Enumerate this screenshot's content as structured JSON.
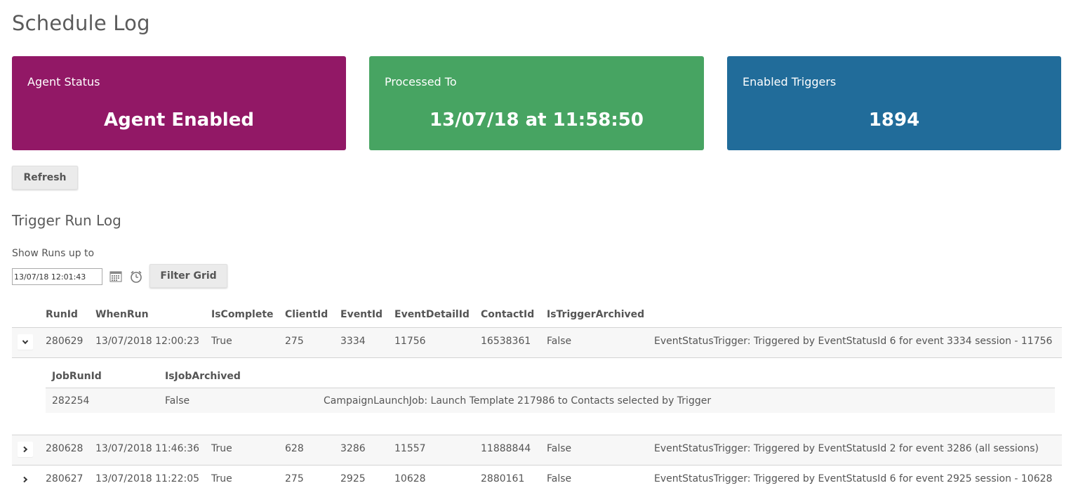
{
  "page": {
    "title": "Schedule Log"
  },
  "cards": {
    "agent_status": {
      "label": "Agent Status",
      "value": "Agent Enabled",
      "color": "#921866"
    },
    "processed_to": {
      "label": "Processed To",
      "value": "13/07/18 at 11:58:50",
      "color": "#47a462"
    },
    "enabled_triggers": {
      "label": "Enabled Triggers",
      "value": "1894",
      "color": "#216c9a"
    }
  },
  "toolbar": {
    "refresh_label": "Refresh"
  },
  "trigger_log": {
    "title": "Trigger Run Log",
    "filter_label": "Show Runs up to",
    "date_value": "13/07/18 12:01:43",
    "filter_button": "Filter Grid",
    "icons": [
      "calendar-icon",
      "clock-icon"
    ]
  },
  "grid": {
    "columns": [
      "RunId",
      "WhenRun",
      "IsComplete",
      "ClientId",
      "EventId",
      "EventDetailId",
      "ContactId",
      "IsTriggerArchived"
    ],
    "rows": [
      {
        "run_id": "280629",
        "when_run": "13/07/2018 12:00:23",
        "is_complete": "True",
        "client_id": "275",
        "event_id": "3334",
        "event_detail_id": "11756",
        "contact_id": "16538361",
        "is_trigger_archived": "False",
        "description": "EventStatusTrigger: Triggered by EventStatusId 6 for event 3334 session - 11756",
        "expanded": true
      },
      {
        "run_id": "280628",
        "when_run": "13/07/2018 11:46:36",
        "is_complete": "True",
        "client_id": "628",
        "event_id": "3286",
        "event_detail_id": "11557",
        "contact_id": "11888844",
        "is_trigger_archived": "False",
        "description": "EventStatusTrigger: Triggered by EventStatusId 2 for event 3286 (all sessions)",
        "expanded": false
      },
      {
        "run_id": "280627",
        "when_run": "13/07/2018 11:22:05",
        "is_complete": "True",
        "client_id": "275",
        "event_id": "2925",
        "event_detail_id": "10628",
        "contact_id": "2880161",
        "is_trigger_archived": "False",
        "description": "EventStatusTrigger: Triggered by EventStatusId 6 for event 2925 session - 10628",
        "expanded": false
      }
    ],
    "detail": {
      "columns": [
        "JobRunId",
        "IsJobArchived"
      ],
      "rows": [
        {
          "job_run_id": "282254",
          "is_job_archived": "False",
          "description": "CampaignLaunchJob: Launch Template 217986 to Contacts selected by Trigger"
        }
      ]
    }
  }
}
